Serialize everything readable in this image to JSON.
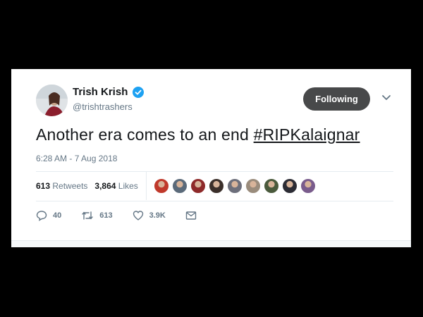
{
  "tweet": {
    "display_name": "Trish Krish",
    "handle": "@trishtrashers",
    "follow_label": "Following",
    "text_plain": "Another era comes to an end ",
    "hashtag": "#RIPKalaignar",
    "timestamp": "6:28 AM - 7 Aug 2018",
    "stats": {
      "retweets_count": "613",
      "retweets_label": "Retweets",
      "likes_count": "3,864",
      "likes_label": "Likes"
    },
    "actions": {
      "reply_count": "40",
      "retweet_count": "613",
      "like_count": "3.9K"
    }
  },
  "colors": {
    "verified": "#1da1f2",
    "follow_button": "#48494a",
    "muted_text": "#657786",
    "primary_text": "#14171a"
  },
  "likers": [
    {
      "icon": "liker-avatar",
      "color": "#c0392b"
    },
    {
      "icon": "liker-avatar",
      "color": "#5b6a7a"
    },
    {
      "icon": "liker-avatar",
      "color": "#8e2a2a"
    },
    {
      "icon": "liker-avatar",
      "color": "#3b2f2a"
    },
    {
      "icon": "liker-avatar",
      "color": "#6d6f7b"
    },
    {
      "icon": "liker-avatar",
      "color": "#9a8c7c"
    },
    {
      "icon": "liker-avatar",
      "color": "#4a5a3c"
    },
    {
      "icon": "liker-avatar",
      "color": "#2c2c34"
    },
    {
      "icon": "liker-avatar",
      "color": "#7a5c8c"
    }
  ]
}
